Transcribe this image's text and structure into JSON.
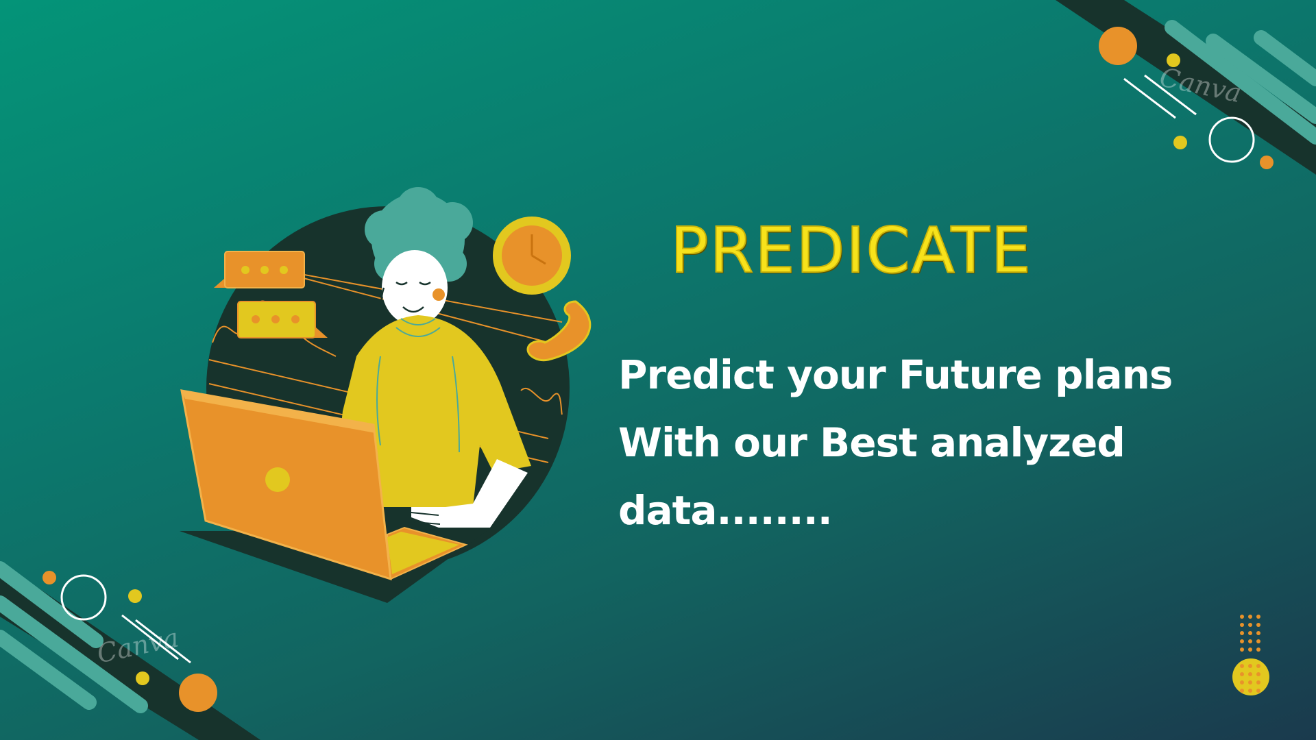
{
  "hero": {
    "title": "PREDICATE",
    "tagline_lines": [
      "Predict your Future plans",
      "With our Best analyzed",
      "data........"
    ]
  },
  "watermark": {
    "text_top": "Canva",
    "text_bottom": "Canva"
  },
  "illustration": {
    "subject": "person-typing-on-laptop",
    "icons": [
      "chat-bubble-icon",
      "chat-bubble-icon",
      "clock-icon",
      "phone-icon",
      "laptop-icon"
    ]
  },
  "colors": {
    "background_start": "#049478",
    "background_end": "#1a3a4d",
    "title": "#f7e21b",
    "tagline": "#ffffff",
    "accent_orange": "#e8922a",
    "accent_yellow": "#e2c81f",
    "accent_teal": "#4aa99a",
    "dark_circle": "#17332c"
  }
}
